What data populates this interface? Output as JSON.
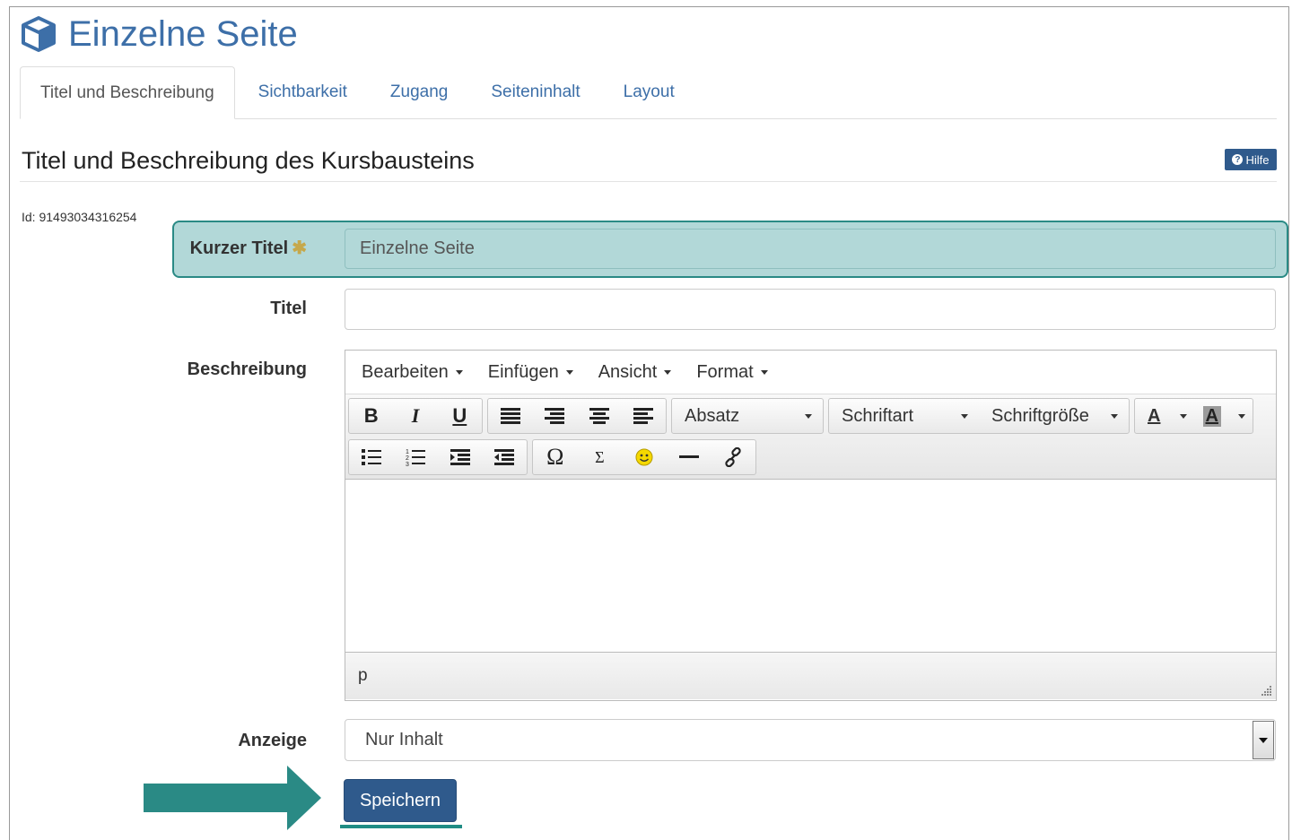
{
  "page": {
    "title": "Einzelne Seite",
    "icon": "cube-icon",
    "accent_color": "#3d6fa8"
  },
  "tabs": [
    {
      "label": "Titel und Beschreibung",
      "active": true
    },
    {
      "label": "Sichtbarkeit",
      "active": false
    },
    {
      "label": "Zugang",
      "active": false
    },
    {
      "label": "Seiteninhalt",
      "active": false
    },
    {
      "label": "Layout",
      "active": false
    }
  ],
  "section": {
    "heading": "Titel und Beschreibung des Kursbausteins",
    "help_label": "Hilfe"
  },
  "id_text": "Id: 91493034316254",
  "form": {
    "short_title": {
      "label": "Kurzer Titel",
      "required_mark": "✱",
      "value": "Einzelne Seite"
    },
    "title": {
      "label": "Titel",
      "value": ""
    },
    "description": {
      "label": "Beschreibung"
    },
    "display": {
      "label": "Anzeige",
      "value": "Nur Inhalt"
    },
    "save_label": "Speichern"
  },
  "editor": {
    "menu": [
      "Bearbeiten",
      "Einfügen",
      "Ansicht",
      "Format"
    ],
    "toolbar_row1": {
      "format_buttons": [
        "B",
        "I",
        "U"
      ],
      "align_icons": [
        "align-left-icon",
        "align-right-icon",
        "align-center-icon",
        "align-justify-icon"
      ],
      "block_select": "Absatz",
      "font_select": "Schriftart",
      "size_select": "Schriftgröße",
      "text_color_label": "A",
      "background_color_label": "A"
    },
    "toolbar_row2": {
      "list_icons": [
        "bullet-list-icon",
        "numbered-list-icon",
        "indent-icon",
        "outdent-icon"
      ],
      "insert_icons": [
        "omega-icon",
        "sigma-icon",
        "smiley-icon",
        "horizontal-rule-icon",
        "link-icon"
      ],
      "omega": "Ω",
      "sigma": "Σ"
    },
    "status_path": "p"
  },
  "colors": {
    "highlight": "#b2d8d8",
    "highlight_border": "#2a8a85",
    "button": "#2f5a8c",
    "arrow": "#2a8a85",
    "required_star": "#c6a84a"
  }
}
